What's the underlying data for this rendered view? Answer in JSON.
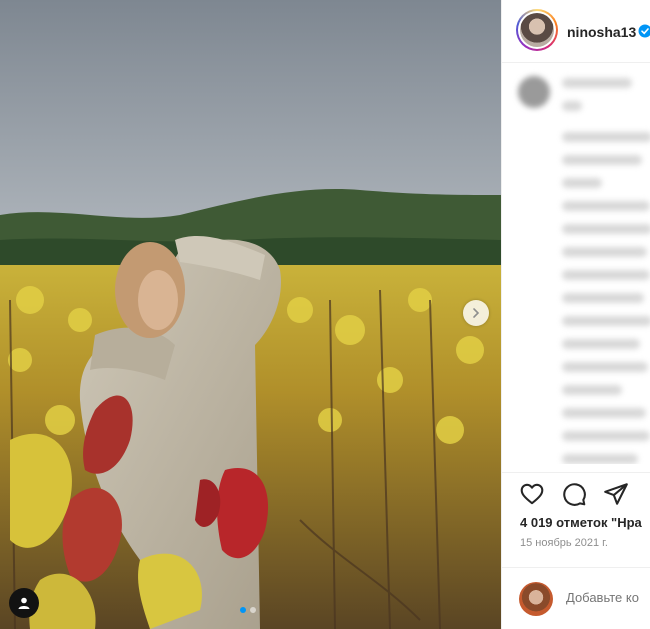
{
  "post": {
    "username": "ninosha13",
    "verified": true,
    "likes_text": "4 019 отметок \"Нра",
    "date_text": "15 ноябрь 2021 г.",
    "comment_placeholder": "Добавьте ко",
    "carousel": {
      "slides": 2,
      "active_index": 0
    }
  },
  "icons": {
    "next": "chevron-right-icon",
    "tag": "user-tag-icon",
    "like": "heart-icon",
    "comment": "comment-icon",
    "share": "paper-plane-icon",
    "verified": "verified-badge-icon"
  },
  "colors": {
    "accent": "#0095f6",
    "text": "#262626",
    "muted": "#8e8e8e",
    "border": "#efefef"
  }
}
